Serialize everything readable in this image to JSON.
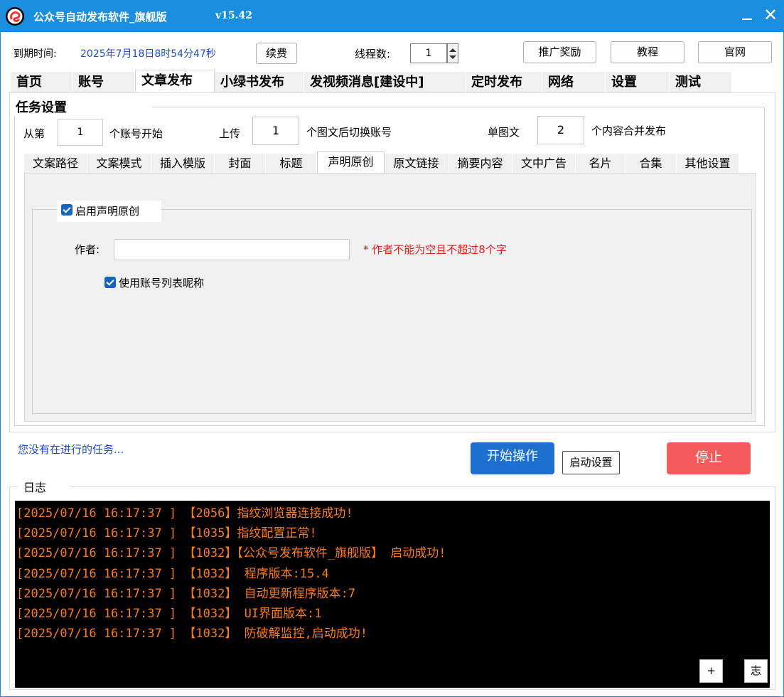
{
  "window": {
    "title": "公众号自动发布软件_旗舰版",
    "version": "v15.42"
  },
  "topbar": {
    "expire_label": "到期时间:",
    "expire_value": "2025年7月18日8时54分47秒",
    "renew_label": "续费",
    "threads_label": "线程数:",
    "threads_value": "1",
    "promote_label": "推广奖励",
    "tutorial_label": "教程",
    "website_label": "官网"
  },
  "main_tabs": [
    {
      "label": "首页"
    },
    {
      "label": "账号"
    },
    {
      "label": "文章发布",
      "active": true
    },
    {
      "label": "小绿书发布"
    },
    {
      "label": "发视频消息[建设中]"
    },
    {
      "label": "定时发布"
    },
    {
      "label": "网络"
    },
    {
      "label": "设置"
    },
    {
      "label": "测试"
    }
  ],
  "task": {
    "legend": "任务设置",
    "from_label": "从第",
    "from_value": "1",
    "from_suffix": "个账号开始",
    "upload_label": "上传",
    "upload_value": "1",
    "upload_suffix": "个图文后切换账号",
    "single_label": "单图文",
    "single_value": "2",
    "single_suffix": "个内容合并发布"
  },
  "sub_tabs": [
    {
      "label": "文案路径"
    },
    {
      "label": "文案模式"
    },
    {
      "label": "插入模版"
    },
    {
      "label": "封面"
    },
    {
      "label": "标题"
    },
    {
      "label": "声明原创",
      "active": true
    },
    {
      "label": "原文链接"
    },
    {
      "label": "摘要内容"
    },
    {
      "label": "文中广告"
    },
    {
      "label": "名片"
    },
    {
      "label": "合集"
    },
    {
      "label": "其他设置"
    }
  ],
  "original": {
    "enable_label": "启用声明原创",
    "enable_checked": true,
    "author_label": "作者:",
    "author_value": "",
    "author_hint": "* 作者不能为空且不超过8个字",
    "use_nick_label": "使用账号列表昵称",
    "use_nick_checked": true
  },
  "status": {
    "text": "您没有在进行的任务...",
    "start_label": "开始操作",
    "startup_settings_label": "启动设置",
    "stop_label": "停止"
  },
  "log": {
    "legend": "日志",
    "lines": [
      "[2025/07/16 16:17:37 ] 【2056】指纹浏览器连接成功!",
      "[2025/07/16 16:17:37 ] 【1035】指纹配置正常!",
      "[2025/07/16 16:17:37 ] 【1032】【公众号发布软件_旗舰版】 启动成功!",
      "[2025/07/16 16:17:37 ] 【1032】 程序版本:15.4",
      "[2025/07/16 16:17:37 ] 【1032】 自动更新程序版本:7",
      "[2025/07/16 16:17:37 ] 【1032】 UI界面版本:1",
      "[2025/07/16 16:17:37 ] 【1032】 防破解监控,启动成功!"
    ],
    "plus_label": "+",
    "clear_label": "志"
  },
  "colors": {
    "titlebar": "#1a8fe0",
    "start_button": "#1d6fd0",
    "stop_button": "#f45b5b",
    "log_text": "#f57c1f",
    "hint_text": "#e0201f",
    "link_text": "#1f4fd1"
  },
  "icons": {
    "app_logo": "app-logo-icon",
    "minimize": "minimize-icon",
    "close": "close-icon",
    "checkbox": "checkbox-checked-icon",
    "spinner": "spinner-arrows-icon"
  }
}
